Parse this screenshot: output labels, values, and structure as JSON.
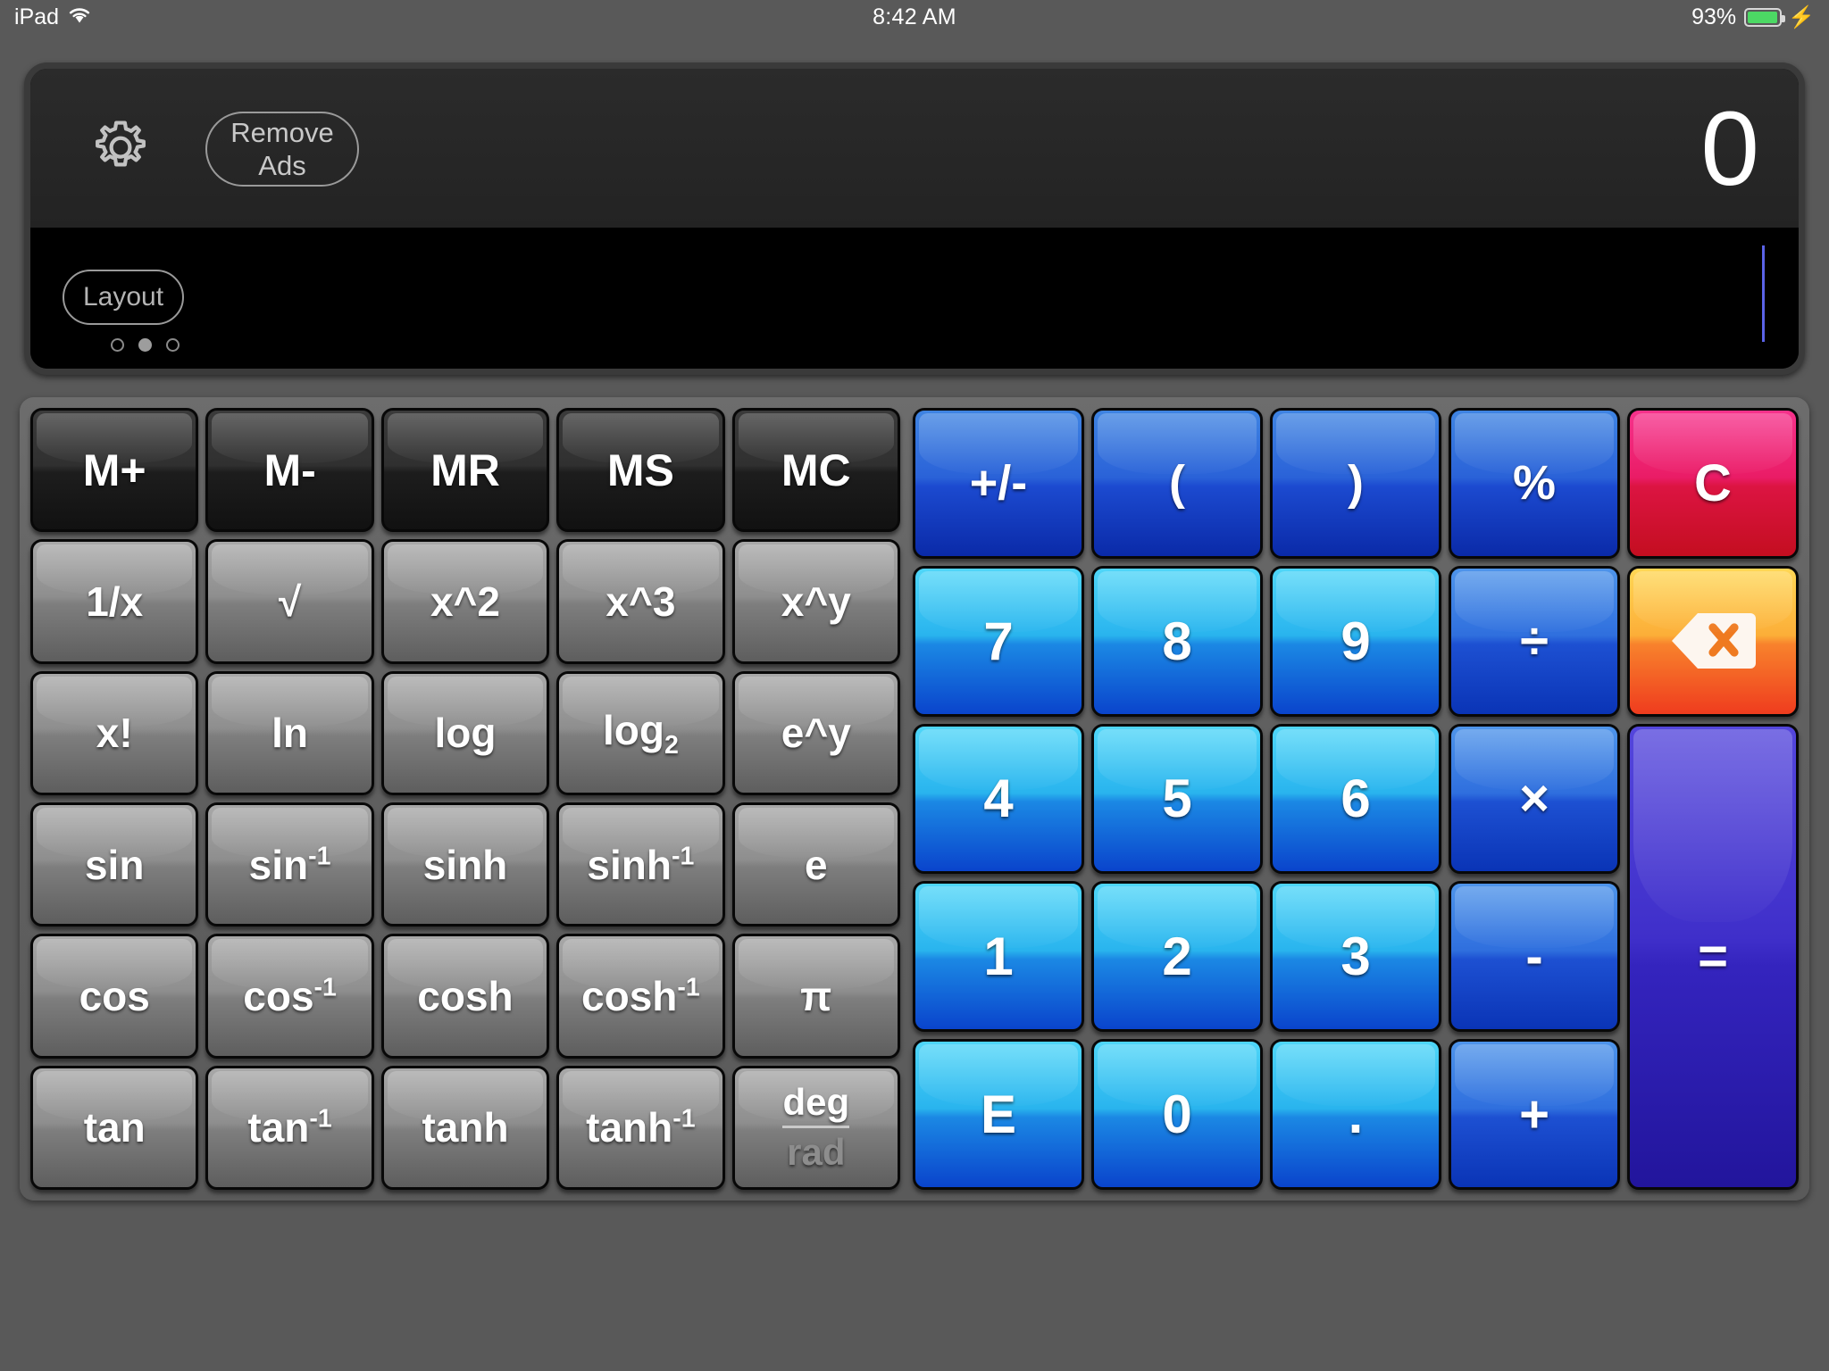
{
  "status_bar": {
    "device": "iPad",
    "wifi_icon": "wifi-icon",
    "time": "8:42 AM",
    "battery_percent": "93%",
    "battery_icon": "battery-charging-icon",
    "charging_bolt": "⚡"
  },
  "display": {
    "gear_icon": "gear-icon",
    "remove_ads_label": "Remove Ads",
    "result_value": "0",
    "layout_label": "Layout",
    "page_dots": {
      "count": 3,
      "active_index": 1
    },
    "caret_color": "#5b63e8"
  },
  "keypad": {
    "scientific": [
      {
        "label": "M+",
        "name": "memory-add-key",
        "style": "key-mem"
      },
      {
        "label": "M-",
        "name": "memory-subtract-key",
        "style": "key-mem"
      },
      {
        "label": "MR",
        "name": "memory-recall-key",
        "style": "key-mem"
      },
      {
        "label": "MS",
        "name": "memory-store-key",
        "style": "key-mem"
      },
      {
        "label": "MC",
        "name": "memory-clear-key",
        "style": "key-mem"
      },
      {
        "label": "1/x",
        "name": "reciprocal-key",
        "style": "key-fn"
      },
      {
        "label": "√",
        "name": "square-root-key",
        "style": "key-fn"
      },
      {
        "label": "x^2",
        "name": "square-key",
        "style": "key-fn"
      },
      {
        "label": "x^3",
        "name": "cube-key",
        "style": "key-fn"
      },
      {
        "label": "x^y",
        "name": "power-key",
        "style": "key-fn"
      },
      {
        "label": "x!",
        "name": "factorial-key",
        "style": "key-fn"
      },
      {
        "label": "ln",
        "name": "natural-log-key",
        "style": "key-fn"
      },
      {
        "label": "log",
        "name": "log-key",
        "style": "key-fn"
      },
      {
        "label": "log",
        "sub": "2",
        "name": "log-base-2-key",
        "style": "key-fn"
      },
      {
        "label": "e^y",
        "name": "exp-key",
        "style": "key-fn"
      },
      {
        "label": "sin",
        "name": "sin-key",
        "style": "key-fn"
      },
      {
        "label": "sin",
        "sup": "-1",
        "name": "arcsin-key",
        "style": "key-fn"
      },
      {
        "label": "sinh",
        "name": "sinh-key",
        "style": "key-fn"
      },
      {
        "label": "sinh",
        "sup": "-1",
        "name": "arcsinh-key",
        "style": "key-fn"
      },
      {
        "label": "e",
        "name": "euler-constant-key",
        "style": "key-fn"
      },
      {
        "label": "cos",
        "name": "cos-key",
        "style": "key-fn"
      },
      {
        "label": "cos",
        "sup": "-1",
        "name": "arccos-key",
        "style": "key-fn"
      },
      {
        "label": "cosh",
        "name": "cosh-key",
        "style": "key-fn"
      },
      {
        "label": "cosh",
        "sup": "-1",
        "name": "arccosh-key",
        "style": "key-fn"
      },
      {
        "label": "π",
        "name": "pi-key",
        "style": "key-fn"
      },
      {
        "label": "tan",
        "name": "tan-key",
        "style": "key-fn"
      },
      {
        "label": "tan",
        "sup": "-1",
        "name": "arctan-key",
        "style": "key-fn"
      },
      {
        "label": "tanh",
        "name": "tanh-key",
        "style": "key-fn"
      },
      {
        "label": "tanh",
        "sup": "-1",
        "name": "arctanh-key",
        "style": "key-fn"
      },
      {
        "label": "",
        "name": "deg-rad-toggle-key",
        "style": "key-fn degrad",
        "deg": "deg",
        "rad": "rad",
        "active_mode": "deg"
      }
    ],
    "numeric": [
      {
        "label": "+/-",
        "name": "sign-toggle-key",
        "style": "key-top"
      },
      {
        "label": "(",
        "name": "open-paren-key",
        "style": "key-top"
      },
      {
        "label": ")",
        "name": "close-paren-key",
        "style": "key-top"
      },
      {
        "label": "%",
        "name": "percent-key",
        "style": "key-top"
      },
      {
        "label": "C",
        "name": "clear-key",
        "style": "key-clear"
      },
      {
        "label": "7",
        "name": "digit-7-key",
        "style": "key-num"
      },
      {
        "label": "8",
        "name": "digit-8-key",
        "style": "key-num"
      },
      {
        "label": "9",
        "name": "digit-9-key",
        "style": "key-num"
      },
      {
        "label": "÷",
        "name": "divide-key",
        "style": "key-op"
      },
      {
        "label": "",
        "name": "backspace-key",
        "style": "key-back",
        "icon": "backspace-icon"
      },
      {
        "label": "4",
        "name": "digit-4-key",
        "style": "key-num"
      },
      {
        "label": "5",
        "name": "digit-5-key",
        "style": "key-num"
      },
      {
        "label": "6",
        "name": "digit-6-key",
        "style": "key-num"
      },
      {
        "label": "×",
        "name": "multiply-key",
        "style": "key-op"
      },
      {
        "label": "=",
        "name": "equals-key",
        "style": "key-equals"
      },
      {
        "label": "1",
        "name": "digit-1-key",
        "style": "key-num"
      },
      {
        "label": "2",
        "name": "digit-2-key",
        "style": "key-num"
      },
      {
        "label": "3",
        "name": "digit-3-key",
        "style": "key-num"
      },
      {
        "label": "-",
        "name": "subtract-key",
        "style": "key-op"
      },
      {
        "label": "E",
        "name": "exponent-key",
        "style": "key-num"
      },
      {
        "label": "0",
        "name": "digit-0-key",
        "style": "key-num"
      },
      {
        "label": ".",
        "name": "decimal-point-key",
        "style": "key-num"
      },
      {
        "label": "+",
        "name": "add-key",
        "style": "key-op"
      }
    ]
  }
}
